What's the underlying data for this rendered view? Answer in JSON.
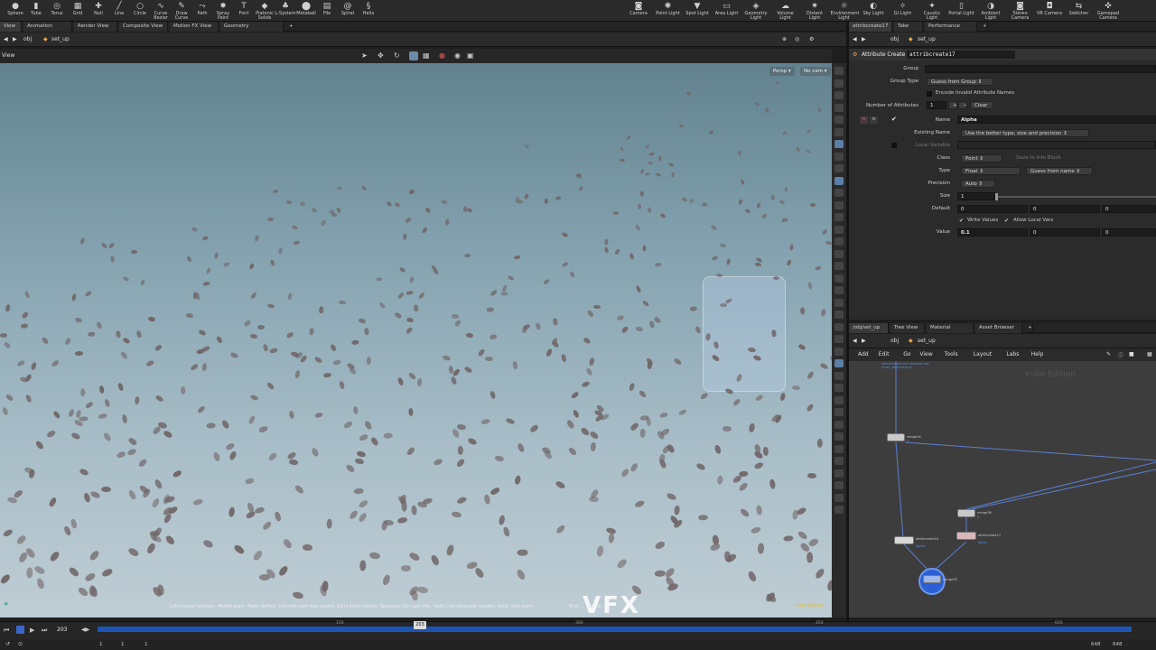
{
  "shelf_tools_left": [
    {
      "label": "Sphere",
      "icon": "sphere-icon"
    },
    {
      "label": "Tube",
      "icon": "tube-icon"
    },
    {
      "label": "Torus",
      "icon": "torus-icon"
    },
    {
      "label": "Grid",
      "icon": "grid-icon"
    },
    {
      "label": "Null",
      "icon": "null-icon"
    },
    {
      "label": "Line",
      "icon": "line-icon"
    },
    {
      "label": "Circle",
      "icon": "circle-icon"
    },
    {
      "label": "Curve Bezier",
      "icon": "curve-bezier-icon"
    },
    {
      "label": "Draw Curve",
      "icon": "draw-curve-icon"
    },
    {
      "label": "Path",
      "icon": "path-icon"
    },
    {
      "label": "Spray Paint",
      "icon": "spray-paint-icon"
    },
    {
      "label": "Font",
      "icon": "font-icon"
    },
    {
      "label": "Platonic Solids",
      "icon": "platonic-icon"
    },
    {
      "label": "L-System",
      "icon": "lsystem-icon"
    },
    {
      "label": "Metaball",
      "icon": "metaball-icon"
    },
    {
      "label": "File",
      "icon": "file-icon"
    },
    {
      "label": "Spiral",
      "icon": "spiral-icon"
    },
    {
      "label": "Helix",
      "icon": "helix-icon"
    }
  ],
  "shelf_tools_right": [
    {
      "label": "Camera",
      "icon": "camera-icon"
    },
    {
      "label": "Point Light",
      "icon": "point-light-icon"
    },
    {
      "label": "Spot Light",
      "icon": "spot-light-icon"
    },
    {
      "label": "Area Light",
      "icon": "area-light-icon"
    },
    {
      "label": "Geometry Light",
      "icon": "geometry-light-icon"
    },
    {
      "label": "Volume Light",
      "icon": "volume-light-icon"
    },
    {
      "label": "Distant Light",
      "icon": "distant-light-icon"
    },
    {
      "label": "Environment Light",
      "icon": "environment-light-icon"
    },
    {
      "label": "Sky Light",
      "icon": "sky-light-icon"
    },
    {
      "label": "GI Light",
      "icon": "gi-light-icon"
    },
    {
      "label": "Caustic Light",
      "icon": "caustic-light-icon"
    },
    {
      "label": "Portal Light",
      "icon": "portal-light-icon"
    },
    {
      "label": "Ambient Light",
      "icon": "ambient-light-icon"
    },
    {
      "label": "Stereo Camera",
      "icon": "stereo-camera-icon"
    },
    {
      "label": "VR Camera",
      "icon": "vr-camera-icon"
    },
    {
      "label": "Switcher",
      "icon": "switcher-icon"
    },
    {
      "label": "Gamepad Camera",
      "icon": "gamepad-camera-icon"
    }
  ],
  "left_tabs": [
    "View",
    "Animation Editor",
    "Render View",
    "Composite View",
    "Motion FX View",
    "Geometry Spreadsheet"
  ],
  "right_tabs": [
    "attribcreate17",
    "Take List",
    "Performance Monitor"
  ],
  "path_left": {
    "root": "obj",
    "node": "set_up"
  },
  "path_right": {
    "root": "obj",
    "node": "set_up"
  },
  "viewport": {
    "title": "View",
    "persp": "Persp",
    "cam": "No cam",
    "status": "Left mouse tumbles. Middle pans. Right dollies. Ctrl+Alt+Left box-zooms. Ctrl+Right zooms. Spacebar-Ctrl-Left tilts. Hold L for alternate tumble, dolly, and zoom.",
    "status2": "M or ... gation.",
    "edition": "Indie Edition",
    "watermark": "VFX"
  },
  "params": {
    "node_type": "Attribute Create",
    "node_name": "attribcreate17",
    "group_label": "Group",
    "group_value": "",
    "group_type_label": "Group Type",
    "group_type_value": "Guess from Group",
    "encode_label": "Encode Invalid Attribute Names",
    "num_attr_label": "Number of Attributes",
    "num_attr_value": "1",
    "clear_label": "Clear",
    "name_label": "Name",
    "name_value": "Alpha",
    "existing_label": "Existing Name",
    "existing_value": "Use the better type, size and precision",
    "local_var_label": "Local Variable",
    "class_label": "Class",
    "class_value": "Point",
    "save_info_label": "Save to Info Block",
    "type_label": "Type",
    "type_value": "Float",
    "type_guess_value": "Guess from name",
    "precision_label": "Precision",
    "precision_value": "Auto",
    "size_label": "Size",
    "size_value": "1",
    "default_label": "Default",
    "default_values": [
      "0",
      "0",
      "0"
    ],
    "write_values_label": "Write Values",
    "allow_local_label": "Allow Local Vars",
    "value_label": "Value",
    "value_values": [
      "0.1",
      "0",
      "0"
    ]
  },
  "net_tabs": [
    "/obj/set_up",
    "Tree View",
    "Material Palette",
    "Asset Browser"
  ],
  "net_menu": [
    "Add",
    "Edit",
    "Go",
    "View",
    "Tools",
    "Layout",
    "Labs",
    "Help"
  ],
  "net_watermark": "Indie Edition",
  "nodes": [
    {
      "name": "merge34",
      "sub": "G"
    },
    {
      "name": "merge36",
      "sub": "G"
    },
    {
      "name": "attribcreate16",
      "sub": "Alpha"
    },
    {
      "name": "attribcreate17",
      "sub": "Alpha"
    },
    {
      "name": "merge30",
      "sub": "G"
    }
  ],
  "net_top_label": "attribdelete4 out attribdel out mesh_deformcurve",
  "timeline": {
    "current_frame": "203",
    "ticks": [
      "150",
      "300",
      "450",
      "600"
    ],
    "start": "1",
    "start2": "1",
    "end": "648",
    "end2": "648"
  },
  "colors": {
    "accent": "#1d55b5",
    "viewport_top": "#62828f",
    "viewport_bottom": "#bfcdd4",
    "leaf": "#6f6465"
  }
}
